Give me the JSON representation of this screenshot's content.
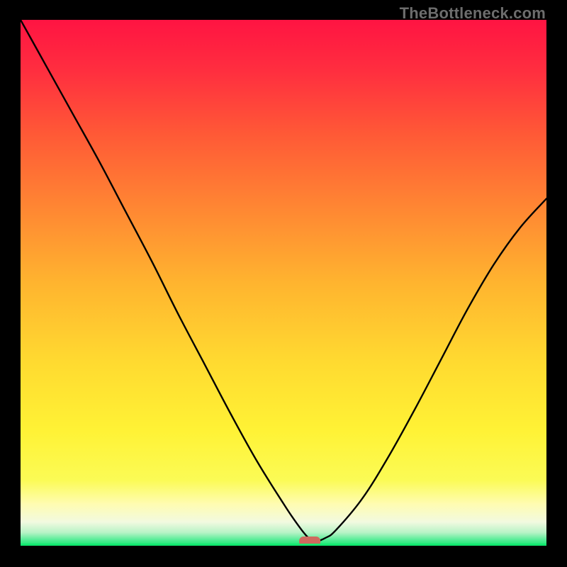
{
  "watermark": "TheBottleneck.com",
  "colors": {
    "frame": "#000000",
    "curve": "#000000",
    "marker_fill": "#cf6a5e",
    "green": "#12e970",
    "gradient_stops": [
      {
        "offset": 0.0,
        "color": "#ff1442"
      },
      {
        "offset": 0.1,
        "color": "#ff2f3f"
      },
      {
        "offset": 0.22,
        "color": "#ff5a36"
      },
      {
        "offset": 0.35,
        "color": "#ff8433"
      },
      {
        "offset": 0.5,
        "color": "#ffb42f"
      },
      {
        "offset": 0.65,
        "color": "#ffda30"
      },
      {
        "offset": 0.78,
        "color": "#fff235"
      },
      {
        "offset": 0.875,
        "color": "#fbfb55"
      },
      {
        "offset": 0.92,
        "color": "#fffcb0"
      },
      {
        "offset": 0.955,
        "color": "#f2fae0"
      },
      {
        "offset": 0.975,
        "color": "#b7f3c6"
      },
      {
        "offset": 0.99,
        "color": "#4dec92"
      },
      {
        "offset": 1.0,
        "color": "#12e970"
      }
    ]
  },
  "chart_data": {
    "type": "line",
    "title": "",
    "xlabel": "",
    "ylabel": "",
    "xlim": [
      0,
      100
    ],
    "ylim": [
      0,
      100
    ],
    "grid": false,
    "series": [
      {
        "name": "bottleneck-curve",
        "x": [
          0,
          5,
          10,
          15,
          20,
          25,
          30,
          35,
          40,
          45,
          50,
          52,
          54,
          55,
          56,
          58,
          60,
          65,
          70,
          75,
          80,
          85,
          90,
          95,
          100
        ],
        "y": [
          100,
          91,
          82,
          73,
          63.5,
          54,
          44,
          34.5,
          25,
          16,
          8,
          5,
          2.3,
          1.3,
          0.8,
          1.5,
          3,
          9,
          17,
          26,
          35.5,
          45,
          53.5,
          60.5,
          66
        ]
      }
    ],
    "annotations": [
      {
        "name": "optimal-marker",
        "x": 55,
        "y": 0.8
      }
    ]
  }
}
